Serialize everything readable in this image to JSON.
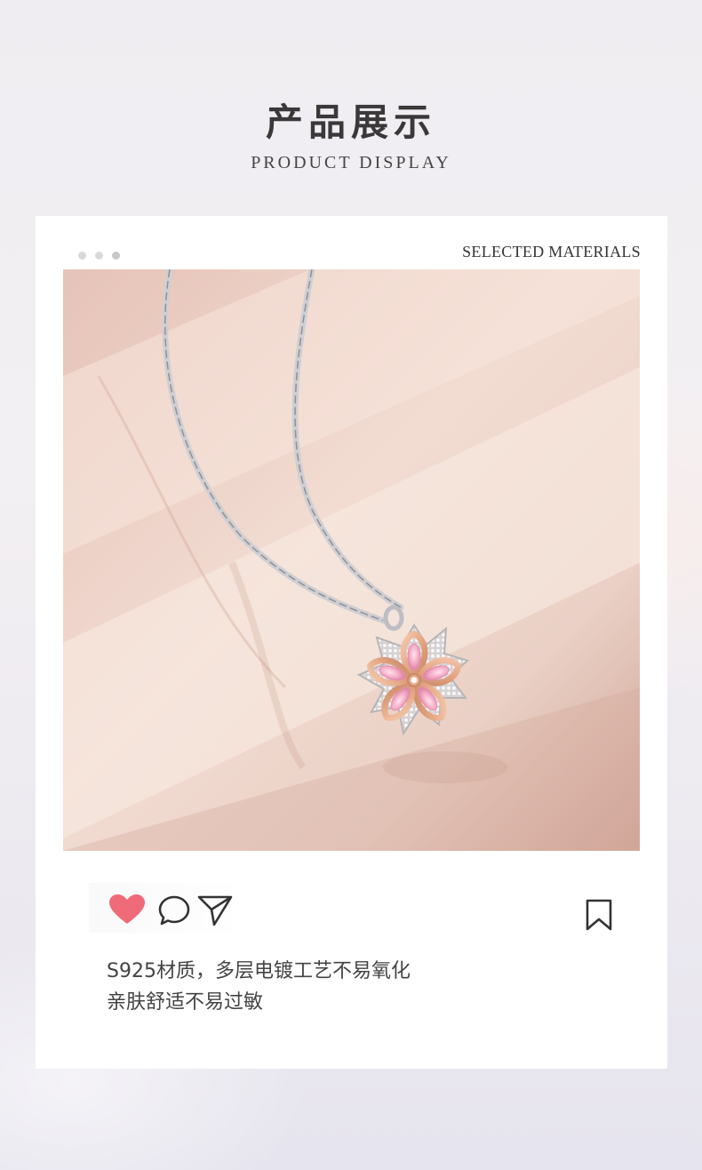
{
  "header": {
    "title": "产品展示",
    "subtitle": "PRODUCT DISPLAY"
  },
  "card": {
    "label": "SELECTED MATERIALS",
    "photo_alt": "Silver chain necklace with rose-gold cherry blossom pendant set with pink stones",
    "actions": {
      "like": "heart-icon",
      "comment": "comment-icon",
      "share": "paper-plane-icon",
      "save": "bookmark-icon"
    },
    "description": [
      "S925材质，多层电镀工艺不易氧化",
      "亲肤舒适不易过敏"
    ]
  },
  "colors": {
    "heart": "#f06b7a",
    "icon_stroke": "#333333",
    "text": "#444444"
  }
}
